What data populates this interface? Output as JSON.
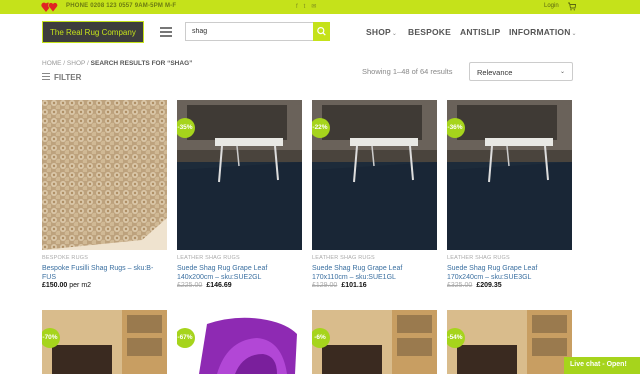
{
  "topbar": {
    "phone": "PHONE 0208 123 0557 9AM-5PM M-F",
    "social_icons": [
      "facebook-icon",
      "twitter-icon",
      "email-icon"
    ],
    "login": "Login",
    "cart_icon": "cart-icon"
  },
  "header": {
    "logo_text": "The Real Rug Company",
    "search": {
      "value": "shag",
      "placeholder": "Search…"
    },
    "nav": [
      {
        "label": "SHOP",
        "has_dropdown": true
      },
      {
        "label": "BESPOKE",
        "has_dropdown": false
      },
      {
        "label": "ANTISLIP",
        "has_dropdown": false
      },
      {
        "label": "INFORMATION",
        "has_dropdown": true
      }
    ]
  },
  "breadcrumb": {
    "home": "HOME",
    "shop": "SHOP",
    "current": "SEARCH RESULTS FOR “SHAG”"
  },
  "filter_label": "FILTER",
  "results_text": "Showing 1–48 of 64 results",
  "sort": {
    "selected": "Relevance"
  },
  "products": [
    {
      "category": "BESPOKE RUGS",
      "name": "Bespoke Fusilli Shag Rugs – sku:B-FUS",
      "price_old": "",
      "price": "£150.00",
      "price_suffix": "per m2",
      "badge": ""
    },
    {
      "category": "LEATHER SHAG RUGS",
      "name": "Suede Shag Rug Grape Leaf 140x200cm – sku:SUE2GL",
      "price_old": "£225.00",
      "price": "£146.69",
      "price_suffix": "",
      "badge": "-35%"
    },
    {
      "category": "LEATHER SHAG RUGS",
      "name": "Suede Shag Rug Grape Leaf 170x110cm – sku:SUE1GL",
      "price_old": "£129.00",
      "price": "£101.16",
      "price_suffix": "",
      "badge": "-22%"
    },
    {
      "category": "LEATHER SHAG RUGS",
      "name": "Suede Shag Rug Grape Leaf 170x240cm – sku:SUE3GL",
      "price_old": "£325.00",
      "price": "£209.35",
      "price_suffix": "",
      "badge": "-36%"
    }
  ],
  "products_row2": [
    {
      "badge": "-70%"
    },
    {
      "badge": "-67%"
    },
    {
      "badge": "-6%"
    },
    {
      "badge": "-54%"
    }
  ],
  "livechat": "Live chat - Open!",
  "colors": {
    "accent": "#c5e21a",
    "badge": "#a6d41c",
    "link": "#3a6fa0"
  }
}
